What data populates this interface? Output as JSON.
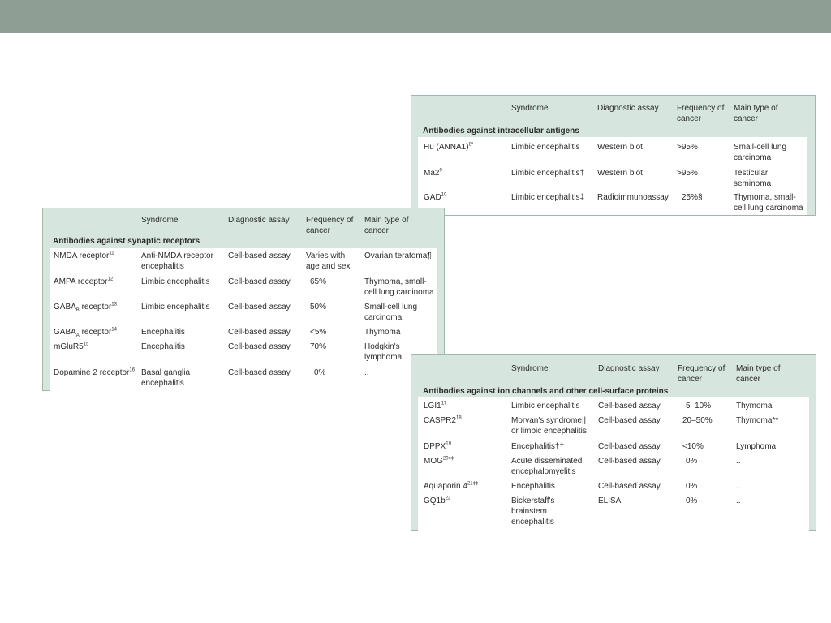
{
  "headers": {
    "syndrome": "Syndrome",
    "assay": "Diagnostic assay",
    "frequency": "Frequency of\ncancer",
    "cancer": "Main type of\ncancer"
  },
  "intracellular": {
    "section": "Antibodies against intracellular antigens",
    "rows": [
      {
        "antibody": "Hu (ANNA1)",
        "ref": "8*",
        "syndrome": "Limbic encephalitis",
        "assay": "Western blot",
        "frequency": ">95%",
        "cancer": "Small-cell lung\ncarcinoma"
      },
      {
        "antibody": "Ma2",
        "ref": "9",
        "syndrome": "Limbic encephalitis†",
        "assay": "Western blot",
        "frequency": ">95%",
        "cancer": "Testicular\nseminoma"
      },
      {
        "antibody": "GAD",
        "ref": "10",
        "syndrome": "Limbic encephalitis‡",
        "assay": "Radioimmunoassay",
        "frequency": "25%§",
        "cancer": "Thymoma, small-\ncell lung carcinoma"
      }
    ]
  },
  "synaptic": {
    "section": "Antibodies against synaptic receptors",
    "rows": [
      {
        "antibody": "NMDA receptor",
        "ref": "11",
        "syndrome": "Anti-NMDA receptor\nencephalitis",
        "assay": "Cell-based assay",
        "frequency": "Varies with\nage and sex",
        "cancer": "Ovarian teratoma¶"
      },
      {
        "antibody": "AMPA receptor",
        "ref": "12",
        "syndrome": "Limbic encephalitis",
        "assay": "Cell-based assay",
        "frequency": "65%",
        "cancer": "Thymoma, small-\ncell lung carcinoma"
      },
      {
        "antibody": "GABA",
        "sub": "B",
        "antibody_tail": " receptor",
        "ref": "13",
        "syndrome": "Limbic encephalitis",
        "assay": "Cell-based assay",
        "frequency": "50%",
        "cancer": "Small-cell lung\ncarcinoma"
      },
      {
        "antibody": "GABA",
        "sub": "A",
        "antibody_tail": " receptor",
        "ref": "14",
        "syndrome": "Encephalitis",
        "assay": "Cell-based assay",
        "frequency": "<5%",
        "cancer": "Thymoma"
      },
      {
        "antibody": "mGluR5",
        "ref": "15",
        "syndrome": "Encephalitis",
        "assay": "Cell-based assay",
        "frequency": "70%",
        "cancer": "Hodgkin's\nlymphoma"
      },
      {
        "antibody": "Dopamine 2 receptor",
        "ref": "16",
        "syndrome": "Basal ganglia\nencephalitis",
        "assay": "Cell-based assay",
        "frequency": "0%",
        "cancer": ".."
      }
    ]
  },
  "ionchannels": {
    "section": "Antibodies against ion channels and other cell-surface proteins",
    "rows": [
      {
        "antibody": "LGI1",
        "ref": "17",
        "syndrome": "Limbic encephalitis",
        "assay": "Cell-based assay",
        "frequency": "5–10%",
        "cancer": "Thymoma"
      },
      {
        "antibody": "CASPR2",
        "ref": "18",
        "syndrome": "Morvan's syndrome||\nor limbic encephalitis",
        "assay": "Cell-based assay",
        "frequency": "20–50%",
        "cancer": "Thymoma**"
      },
      {
        "antibody": "DPPX",
        "ref": "19",
        "syndrome": "Encephalitis††",
        "assay": "Cell-based assay",
        "frequency": "<10%",
        "cancer": "Lymphoma"
      },
      {
        "antibody": "MOG",
        "ref": "20‡‡",
        "syndrome": "Acute disseminated\nencephalomyelitis",
        "assay": "Cell-based assay",
        "frequency": "0%",
        "cancer": ".."
      },
      {
        "antibody": "Aquaporin 4",
        "ref": "21‡‡",
        "syndrome": "Encephalitis",
        "assay": "Cell-based assay",
        "frequency": "0%",
        "cancer": ".."
      },
      {
        "antibody": "GQ1b",
        "ref": "22",
        "syndrome": "Bickerstaff's\nbrainstem\nencephalitis",
        "assay": "ELISA",
        "frequency": "0%",
        "cancer": ".."
      }
    ]
  }
}
